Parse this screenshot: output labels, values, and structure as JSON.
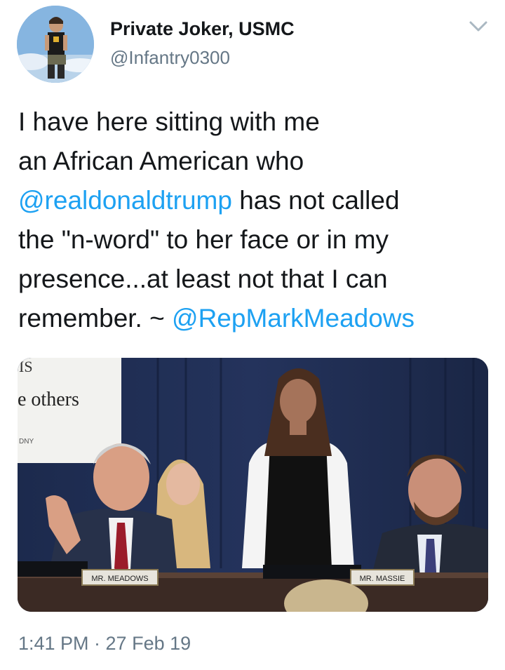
{
  "author": {
    "display_name": "Private Joker, USMC",
    "handle": "@Infantry0300",
    "avatar_icon": "user-avatar-photo"
  },
  "tweet": {
    "lines": [
      [
        {
          "text": "I have here sitting with me",
          "mention": false
        }
      ],
      [
        {
          "text": "an African American who",
          "mention": false
        }
      ],
      [
        {
          "text": "@realdonaldtrump",
          "mention": true
        },
        {
          "text": " has not called",
          "mention": false
        }
      ],
      [
        {
          "text": "the \"n-word\" to her face or in my",
          "mention": false
        }
      ],
      [
        {
          "text": "presence...at least not that I can",
          "mention": false
        }
      ],
      [
        {
          "text": "remember. ~ ",
          "mention": false
        },
        {
          "text": "@RepMarkMeadows",
          "mention": true
        }
      ]
    ]
  },
  "media": {
    "sign_text_1": "IS",
    "sign_text_2": "e others",
    "sign_text_3": "DNY",
    "nameplate_left": "MR. MEADOWS",
    "nameplate_right": "MR. MASSIE"
  },
  "footer": {
    "timestamp": "1:41 PM · 27 Feb 19"
  },
  "colors": {
    "mention": "#1da1f2",
    "secondary_text": "#657786",
    "primary_text": "#14171a"
  }
}
